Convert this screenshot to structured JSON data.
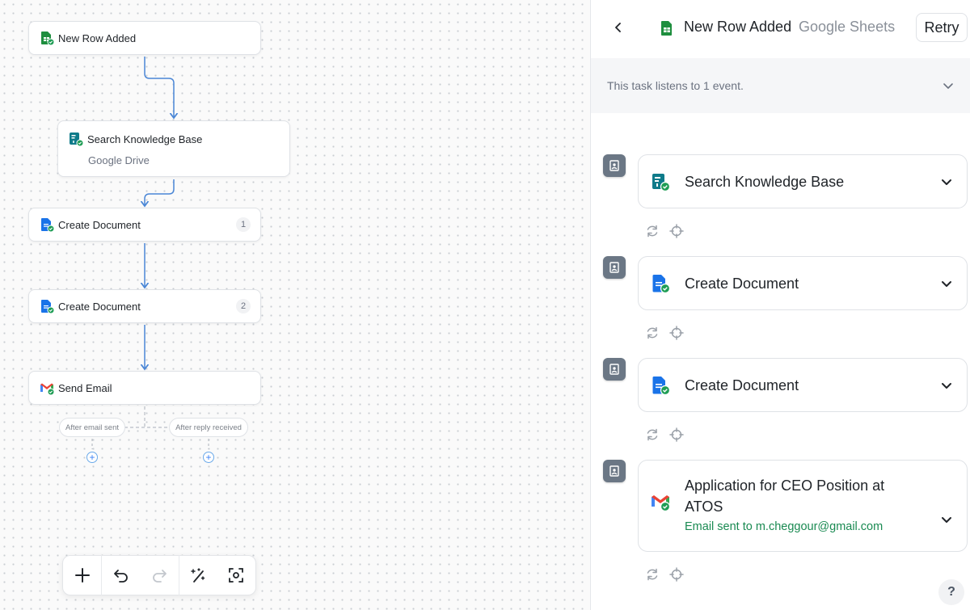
{
  "canvas": {
    "nodes": [
      {
        "label": "New Row Added",
        "icon": "google-sheets-icon"
      },
      {
        "label": "Search Knowledge Base",
        "sublabel": "Google Drive",
        "icon": "google-drive-search-icon"
      },
      {
        "label": "Create Document",
        "badge": "1",
        "icon": "google-docs-icon"
      },
      {
        "label": "Create Document",
        "badge": "2",
        "icon": "google-docs-icon"
      },
      {
        "label": "Send Email",
        "icon": "gmail-icon"
      }
    ],
    "branches": [
      "After email sent",
      "After reply received"
    ],
    "toolbar": [
      "add-icon",
      "undo-icon",
      "redo-icon",
      "auto-layout-icon",
      "fit-view-icon"
    ]
  },
  "panel": {
    "title": "New Row Added",
    "app": "Google Sheets",
    "retry_label": "Retry",
    "info_text": "This task listens to 1 event.",
    "steps": [
      {
        "title": "Search Knowledge Base",
        "icon": "google-drive-search-icon"
      },
      {
        "title": "Create Document",
        "icon": "google-docs-icon"
      },
      {
        "title": "Create Document",
        "icon": "google-docs-icon"
      },
      {
        "title": "Application for CEO Position at ATOS",
        "subtitle": "Email sent to m.cheggour@gmail.com",
        "icon": "gmail-icon"
      }
    ],
    "help_label": "?"
  },
  "colors": {
    "edge": "#4a86d6",
    "success": "#1f9d55",
    "sheets": "#1e8e3e",
    "docs": "#1a73e8",
    "subtitle_green": "#1a8a52"
  }
}
